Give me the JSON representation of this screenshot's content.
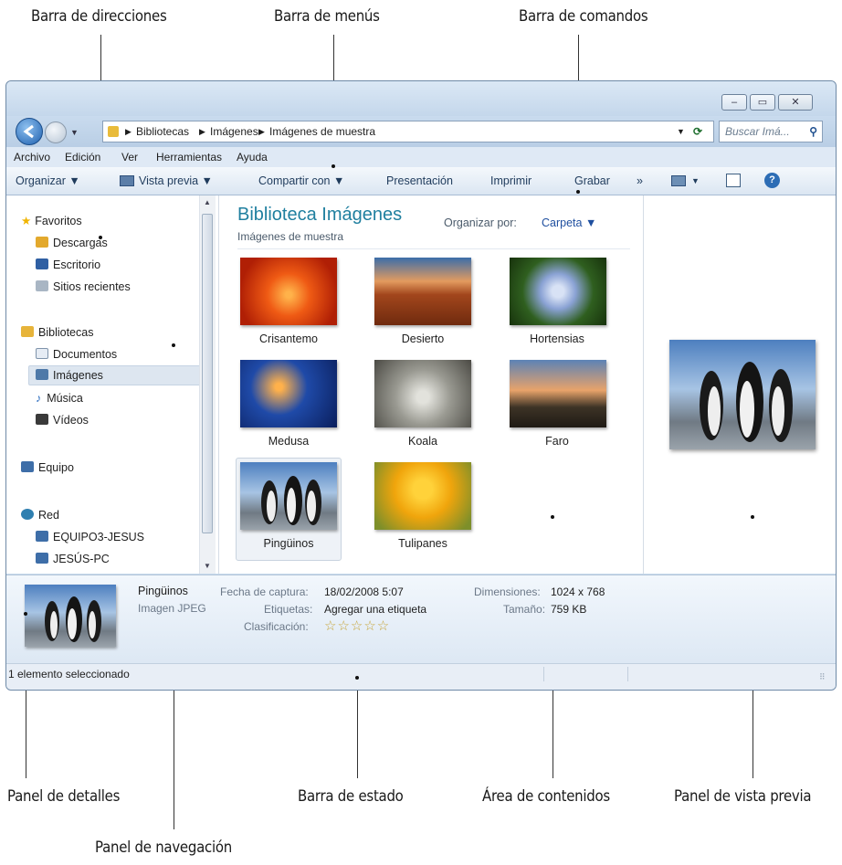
{
  "callouts": {
    "address_bar": "Barra de direcciones",
    "menu_bar": "Barra de menús",
    "command_bar": "Barra de comandos",
    "details_pane": "Panel de detalles",
    "status_bar": "Barra de estado",
    "content_area": "Área de contenidos",
    "preview_pane": "Panel de vista previa",
    "navigation_pane": "Panel de navegación"
  },
  "window": {
    "caption_buttons": {
      "minimize": "‒",
      "maximize": "▭",
      "close": "✕"
    },
    "breadcrumb": [
      "Bibliotecas",
      "Imágenes",
      "Imágenes de muestra"
    ],
    "search_placeholder": "Buscar Imá...",
    "menu": [
      "Archivo",
      "Edición",
      "Ver",
      "Herramientas",
      "Ayuda"
    ],
    "commands": [
      "Organizar ▼",
      "Vista previa ▼",
      "Compartir con ▼",
      "Presentación",
      "Imprimir",
      "Grabar",
      "»"
    ]
  },
  "navigation": {
    "favorites": {
      "label": "Favoritos",
      "items": [
        "Descargas",
        "Escritorio",
        "Sitios recientes"
      ]
    },
    "libraries": {
      "label": "Bibliotecas",
      "items": [
        "Documentos",
        "Imágenes",
        "Música",
        "Vídeos"
      ]
    },
    "computer": "Equipo",
    "network": {
      "label": "Red",
      "items": [
        "EQUIPO3-JESUS",
        "JESÚS-PC"
      ]
    }
  },
  "content": {
    "title": "Biblioteca Imágenes",
    "subtitle": "Imágenes de muestra",
    "arrange_label": "Organizar por:",
    "arrange_value": "Carpeta ▼",
    "files": [
      "Crisantemo",
      "Desierto",
      "Hortensias",
      "Medusa",
      "Koala",
      "Faro",
      "Pingüinos",
      "Tulipanes"
    ]
  },
  "details": {
    "name": "Pingüinos",
    "type": "Imagen JPEG",
    "date_label": "Fecha de captura:",
    "date_value": "18/02/2008 5:07",
    "tags_label": "Etiquetas:",
    "tags_value": "Agregar una etiqueta",
    "rating_label": "Clasificación:",
    "rating_stars": "☆☆☆☆☆",
    "dims_label": "Dimensiones:",
    "dims_value": "1024 x 768",
    "size_label": "Tamaño:",
    "size_value": "759 KB"
  },
  "status": "1 elemento seleccionado",
  "colors": {
    "accent": "#1f7f9f",
    "link": "#1f4f9f",
    "selection": "#dde6f0"
  }
}
